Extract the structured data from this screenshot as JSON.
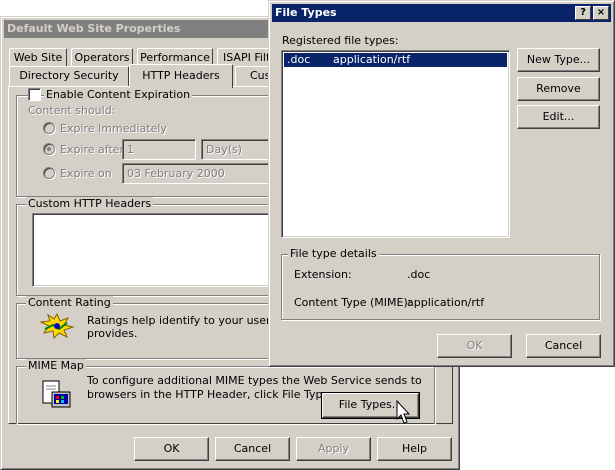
{
  "back_dialog": {
    "title": "Default Web Site Properties",
    "tabs_row1": [
      "Web Site",
      "Operators",
      "Performance",
      "ISAPI Filte"
    ],
    "tabs_row2": [
      "Directory Security",
      "HTTP Headers",
      "Cus"
    ],
    "content_expiration": {
      "checkbox_label": "Enable Content Expiration",
      "content_should": "Content should:",
      "expire_immediately": "Expire Immediately",
      "expire_after": "Expire after",
      "expire_after_value": "1",
      "expire_after_unit": "Day(s)",
      "expire_on": "Expire on",
      "expire_on_value": "03  February  2000"
    },
    "custom_headers_label": "Custom HTTP Headers",
    "content_rating": {
      "label": "Content Rating",
      "text_line1": "Ratings help identify to your users wha",
      "text_line2": "provides."
    },
    "mime_map": {
      "label": "MIME Map",
      "text_line1": "To configure additional MIME types the Web Service sends to",
      "text_line2": "browsers in the HTTP Header, click File Types.",
      "file_types_button": "File Types..."
    },
    "buttons": {
      "ok": "OK",
      "cancel": "Cancel",
      "apply": "Apply",
      "help": "Help"
    }
  },
  "front_dialog": {
    "title": "File Types",
    "close_glyph": "×",
    "help_glyph": "?",
    "registered_label": "Registered file types:",
    "file_types": [
      {
        "extension": ".doc",
        "mime": "application/rtf"
      }
    ],
    "new_type_button": "New Type...",
    "remove_button": "Remove",
    "edit_button": "Edit...",
    "details": {
      "label": "File type details",
      "extension_label": "Extension:",
      "extension_value": ".doc",
      "content_type_label": "Content Type (MIME):",
      "content_type_value": "application/rtf"
    },
    "ok_button": "OK",
    "cancel_button": "Cancel"
  },
  "colors": {
    "title_active": "#0a246a",
    "title_inactive": "#808080",
    "selection": "#0a246a",
    "face": "#d4d0c8"
  }
}
